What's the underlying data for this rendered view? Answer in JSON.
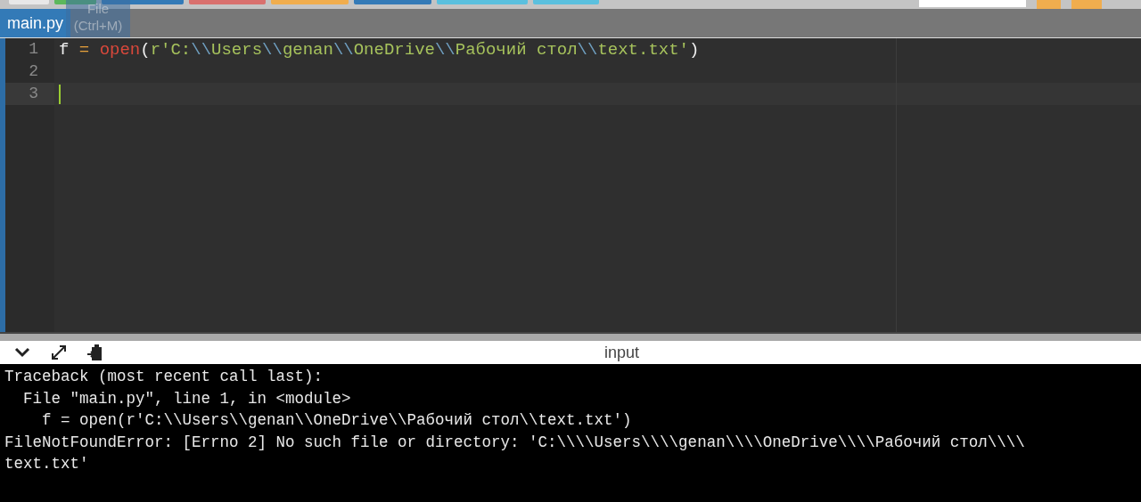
{
  "toolbar": {
    "buttons": [
      {
        "color": "#e8e8e8"
      },
      {
        "color": "#5cb85c"
      },
      {
        "color": "#337ab7"
      },
      {
        "color": "#d9706e"
      },
      {
        "color": "#f0ad4e"
      },
      {
        "color": "#337ab7"
      },
      {
        "color": "#5bc0de"
      },
      {
        "color": "#5bc0de"
      }
    ]
  },
  "tabs": [
    {
      "label": "main.py",
      "selected": true
    }
  ],
  "file_hint": {
    "label": "File",
    "shortcut": "(Ctrl+M)"
  },
  "editor": {
    "lines": [
      {
        "number": "1",
        "active": false,
        "tokens": [
          {
            "kind": "name",
            "text": "f"
          },
          {
            "kind": "operator",
            "text": " = "
          },
          {
            "kind": "builtin",
            "text": "open"
          },
          {
            "kind": "paren",
            "text": "("
          },
          {
            "kind": "string",
            "text": "r'C:"
          },
          {
            "kind": "escape",
            "text": "\\\\"
          },
          {
            "kind": "string",
            "text": "Users"
          },
          {
            "kind": "escape",
            "text": "\\\\"
          },
          {
            "kind": "string",
            "text": "genan"
          },
          {
            "kind": "escape",
            "text": "\\\\"
          },
          {
            "kind": "string",
            "text": "OneDrive"
          },
          {
            "kind": "escape",
            "text": "\\\\"
          },
          {
            "kind": "string",
            "text": "Рабочий стол"
          },
          {
            "kind": "escape",
            "text": "\\\\"
          },
          {
            "kind": "string",
            "text": "text.txt'"
          },
          {
            "kind": "paren",
            "text": ")"
          }
        ]
      },
      {
        "number": "2",
        "active": false
      },
      {
        "number": "3",
        "active": true
      }
    ]
  },
  "output_panel": {
    "title": "input",
    "lines": [
      "Traceback (most recent call last):",
      "  File \"main.py\", line 1, in <module>",
      "    f = open(r'C:\\\\Users\\\\genan\\\\OneDrive\\\\Рабочий стол\\\\text.txt')",
      "FileNotFoundError: [Errno 2] No such file or directory: 'C:\\\\\\\\Users\\\\\\\\genan\\\\\\\\OneDrive\\\\\\\\Рабочий стол\\\\\\\\",
      "text.txt'"
    ]
  }
}
